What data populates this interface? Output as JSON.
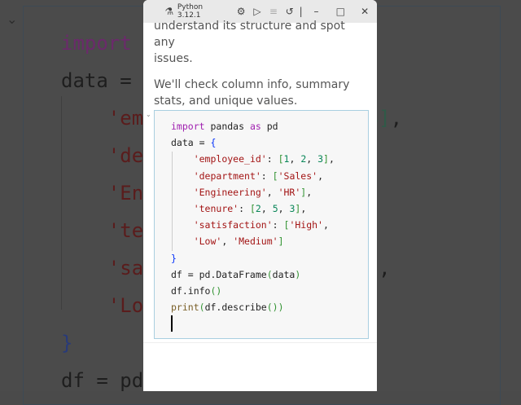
{
  "titlebar": {
    "kernel": "Python 3.12.1"
  },
  "markdown": {
    "line1": "understand its structure and spot any",
    "line2": "issues.",
    "para2": "We'll check column info, summary stats, and unique values."
  },
  "code": [
    "import pandas as pd",
    "data = {",
    "    'employee_id': [1, 2, 3],",
    "    'department': ['Sales',",
    "    'Engineering', 'HR'],",
    "    'tenure': [2, 5, 3],",
    "    'satisfaction': ['High',",
    "    'Low', 'Medium']",
    "}",
    "df = pd.DataFrame(data)",
    "df.info()",
    "print(df.describe())"
  ]
}
